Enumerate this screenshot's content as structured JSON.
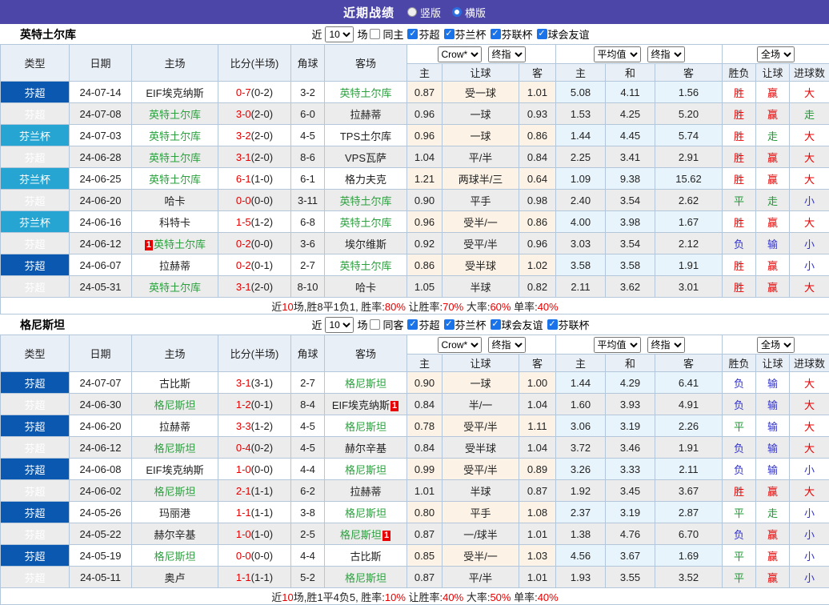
{
  "topbar": {
    "title": "近期战绩",
    "radios": [
      {
        "label": "竖版",
        "selected": false
      },
      {
        "label": "横版",
        "selected": true
      }
    ]
  },
  "icons": {
    "check": "✓"
  },
  "colors": {
    "topbar_purple": "#4c46a8",
    "league_super_blue": "#0a58b0",
    "league_cup_cyan": "#26a5d2",
    "team_highlight_green": "#2d9f3f",
    "win_red": "#e60000",
    "draw_green": "#1d9933",
    "lose_blue": "#3333cc",
    "odds_cream_bg": "#fcf3e6",
    "avg_blue_bg": "#e8f4fb"
  },
  "table_header": {
    "left_cols": [
      "类型",
      "日期",
      "主场",
      "比分(半场)",
      "角球",
      "客场"
    ],
    "odds_cols": [
      "主",
      "让球",
      "客"
    ],
    "avg_cols": [
      "主",
      "和",
      "客"
    ],
    "result_cols": [
      "胜负",
      "让球",
      "进球数"
    ],
    "dropdowns": {
      "crow": "Crow*",
      "final1": "终指",
      "average": "平均值",
      "final2": "终指",
      "fulltime": "全场"
    }
  },
  "sections": [
    {
      "team": "英特土尔库",
      "filter": {
        "prefix": "近",
        "count": "10",
        "suffix": "场",
        "same_label": "同主",
        "leagues": [
          "芬超",
          "芬兰杯",
          "芬联杯",
          "球会友谊"
        ]
      },
      "rows": [
        {
          "lg": "芬超",
          "lgc": "b",
          "d": "24-07-14",
          "h": "EIF埃克纳斯",
          "hg": false,
          "hb": null,
          "s": "0-7",
          "hf": "(0-2)",
          "cn": "3-2",
          "a": "英特土尔库",
          "ag": true,
          "ab": null,
          "o": [
            "0.87",
            "受一球",
            "1.01"
          ],
          "v": [
            "5.08",
            "4.11",
            "1.56"
          ],
          "r": [
            [
              "胜",
              "r"
            ],
            [
              "赢",
              "r"
            ],
            [
              "大",
              "r"
            ]
          ]
        },
        {
          "lg": "芬超",
          "lgc": "b",
          "d": "24-07-08",
          "h": "英特土尔库",
          "hg": true,
          "hb": null,
          "s": "3-0",
          "hf": "(2-0)",
          "cn": "6-0",
          "a": "拉赫蒂",
          "ag": false,
          "ab": null,
          "o": [
            "0.96",
            "一球",
            "0.93"
          ],
          "v": [
            "1.53",
            "4.25",
            "5.20"
          ],
          "r": [
            [
              "胜",
              "r"
            ],
            [
              "赢",
              "r"
            ],
            [
              "走",
              "g"
            ]
          ]
        },
        {
          "lg": "芬兰杯",
          "lgc": "c",
          "d": "24-07-03",
          "h": "英特土尔库",
          "hg": true,
          "hb": null,
          "s": "3-2",
          "hf": "(2-0)",
          "cn": "4-5",
          "a": "TPS土尔库",
          "ag": false,
          "ab": null,
          "o": [
            "0.96",
            "一球",
            "0.86"
          ],
          "v": [
            "1.44",
            "4.45",
            "5.74"
          ],
          "r": [
            [
              "胜",
              "r"
            ],
            [
              "走",
              "g"
            ],
            [
              "大",
              "r"
            ]
          ]
        },
        {
          "lg": "芬超",
          "lgc": "b",
          "d": "24-06-28",
          "h": "英特土尔库",
          "hg": true,
          "hb": null,
          "s": "3-1",
          "hf": "(2-0)",
          "cn": "8-6",
          "a": "VPS瓦萨",
          "ag": false,
          "ab": null,
          "o": [
            "1.04",
            "平/半",
            "0.84"
          ],
          "v": [
            "2.25",
            "3.41",
            "2.91"
          ],
          "r": [
            [
              "胜",
              "r"
            ],
            [
              "赢",
              "r"
            ],
            [
              "大",
              "r"
            ]
          ]
        },
        {
          "lg": "芬兰杯",
          "lgc": "c",
          "d": "24-06-25",
          "h": "英特土尔库",
          "hg": true,
          "hb": null,
          "s": "6-1",
          "hf": "(1-0)",
          "cn": "6-1",
          "a": "格力夫克",
          "ag": false,
          "ab": null,
          "o": [
            "1.21",
            "两球半/三",
            "0.64"
          ],
          "v": [
            "1.09",
            "9.38",
            "15.62"
          ],
          "r": [
            [
              "胜",
              "r"
            ],
            [
              "赢",
              "r"
            ],
            [
              "大",
              "r"
            ]
          ]
        },
        {
          "lg": "芬超",
          "lgc": "b",
          "d": "24-06-20",
          "h": "哈卡",
          "hg": false,
          "hb": null,
          "s": "0-0",
          "hf": "(0-0)",
          "cn": "3-11",
          "a": "英特土尔库",
          "ag": true,
          "ab": null,
          "o": [
            "0.90",
            "平手",
            "0.98"
          ],
          "v": [
            "2.40",
            "3.54",
            "2.62"
          ],
          "r": [
            [
              "平",
              "g"
            ],
            [
              "走",
              "g"
            ],
            [
              "小",
              "b"
            ]
          ]
        },
        {
          "lg": "芬兰杯",
          "lgc": "c",
          "d": "24-06-16",
          "h": "科特卡",
          "hg": false,
          "hb": null,
          "s": "1-5",
          "hf": "(1-2)",
          "cn": "6-8",
          "a": "英特土尔库",
          "ag": true,
          "ab": null,
          "o": [
            "0.96",
            "受半/一",
            "0.86"
          ],
          "v": [
            "4.00",
            "3.98",
            "1.67"
          ],
          "r": [
            [
              "胜",
              "r"
            ],
            [
              "赢",
              "r"
            ],
            [
              "大",
              "r"
            ]
          ]
        },
        {
          "lg": "芬超",
          "lgc": "b",
          "d": "24-06-12",
          "h": "英特土尔库",
          "hg": true,
          "hb": "1",
          "s": "0-2",
          "hf": "(0-0)",
          "cn": "3-6",
          "a": "埃尔维斯",
          "ag": false,
          "ab": null,
          "o": [
            "0.92",
            "受平/半",
            "0.96"
          ],
          "v": [
            "3.03",
            "3.54",
            "2.12"
          ],
          "r": [
            [
              "负",
              "b"
            ],
            [
              "输",
              "b"
            ],
            [
              "小",
              "b"
            ]
          ]
        },
        {
          "lg": "芬超",
          "lgc": "b",
          "d": "24-06-07",
          "h": "拉赫蒂",
          "hg": false,
          "hb": null,
          "s": "0-2",
          "hf": "(0-1)",
          "cn": "2-7",
          "a": "英特土尔库",
          "ag": true,
          "ab": null,
          "o": [
            "0.86",
            "受半球",
            "1.02"
          ],
          "v": [
            "3.58",
            "3.58",
            "1.91"
          ],
          "r": [
            [
              "胜",
              "r"
            ],
            [
              "赢",
              "r"
            ],
            [
              "小",
              "b"
            ]
          ]
        },
        {
          "lg": "芬超",
          "lgc": "b",
          "d": "24-05-31",
          "h": "英特土尔库",
          "hg": true,
          "hb": null,
          "s": "3-1",
          "hf": "(2-0)",
          "cn": "8-10",
          "a": "哈卡",
          "ag": false,
          "ab": null,
          "o": [
            "1.05",
            "半球",
            "0.82"
          ],
          "v": [
            "2.11",
            "3.62",
            "3.01"
          ],
          "r": [
            [
              "胜",
              "r"
            ],
            [
              "赢",
              "r"
            ],
            [
              "大",
              "r"
            ]
          ]
        }
      ],
      "summary": [
        {
          "t": "近",
          "c": "k"
        },
        {
          "t": "10",
          "c": "r"
        },
        {
          "t": "场,胜8平1负1, 胜率:",
          "c": "k"
        },
        {
          "t": "80%",
          "c": "r"
        },
        {
          "t": " 让胜率:",
          "c": "k"
        },
        {
          "t": "70%",
          "c": "r"
        },
        {
          "t": " 大率:",
          "c": "k"
        },
        {
          "t": "60%",
          "c": "r"
        },
        {
          "t": " 单率:",
          "c": "k"
        },
        {
          "t": "40%",
          "c": "r"
        }
      ]
    },
    {
      "team": "格尼斯坦",
      "filter": {
        "prefix": "近",
        "count": "10",
        "suffix": "场",
        "same_label": "同客",
        "leagues": [
          "芬超",
          "芬兰杯",
          "球会友谊",
          "芬联杯"
        ]
      },
      "rows": [
        {
          "lg": "芬超",
          "lgc": "b",
          "d": "24-07-07",
          "h": "古比斯",
          "hg": false,
          "hb": null,
          "s": "3-1",
          "hf": "(3-1)",
          "cn": "2-7",
          "a": "格尼斯坦",
          "ag": true,
          "ab": null,
          "o": [
            "0.90",
            "一球",
            "1.00"
          ],
          "v": [
            "1.44",
            "4.29",
            "6.41"
          ],
          "r": [
            [
              "负",
              "b"
            ],
            [
              "输",
              "b"
            ],
            [
              "大",
              "r"
            ]
          ]
        },
        {
          "lg": "芬超",
          "lgc": "b",
          "d": "24-06-30",
          "h": "格尼斯坦",
          "hg": true,
          "hb": null,
          "s": "1-2",
          "hf": "(0-1)",
          "cn": "8-4",
          "a": "EIF埃克纳斯",
          "ag": false,
          "ab": "1",
          "o": [
            "0.84",
            "半/一",
            "1.04"
          ],
          "v": [
            "1.60",
            "3.93",
            "4.91"
          ],
          "r": [
            [
              "负",
              "b"
            ],
            [
              "输",
              "b"
            ],
            [
              "大",
              "r"
            ]
          ]
        },
        {
          "lg": "芬超",
          "lgc": "b",
          "d": "24-06-20",
          "h": "拉赫蒂",
          "hg": false,
          "hb": null,
          "s": "3-3",
          "hf": "(1-2)",
          "cn": "4-5",
          "a": "格尼斯坦",
          "ag": true,
          "ab": null,
          "o": [
            "0.78",
            "受平/半",
            "1.11"
          ],
          "v": [
            "3.06",
            "3.19",
            "2.26"
          ],
          "r": [
            [
              "平",
              "g"
            ],
            [
              "输",
              "b"
            ],
            [
              "大",
              "r"
            ]
          ]
        },
        {
          "lg": "芬超",
          "lgc": "b",
          "d": "24-06-12",
          "h": "格尼斯坦",
          "hg": true,
          "hb": null,
          "s": "0-4",
          "hf": "(0-2)",
          "cn": "4-5",
          "a": "赫尔辛基",
          "ag": false,
          "ab": null,
          "o": [
            "0.84",
            "受半球",
            "1.04"
          ],
          "v": [
            "3.72",
            "3.46",
            "1.91"
          ],
          "r": [
            [
              "负",
              "b"
            ],
            [
              "输",
              "b"
            ],
            [
              "大",
              "r"
            ]
          ]
        },
        {
          "lg": "芬超",
          "lgc": "b",
          "d": "24-06-08",
          "h": "EIF埃克纳斯",
          "hg": false,
          "hb": null,
          "s": "1-0",
          "hf": "(0-0)",
          "cn": "4-4",
          "a": "格尼斯坦",
          "ag": true,
          "ab": null,
          "o": [
            "0.99",
            "受平/半",
            "0.89"
          ],
          "v": [
            "3.26",
            "3.33",
            "2.11"
          ],
          "r": [
            [
              "负",
              "b"
            ],
            [
              "输",
              "b"
            ],
            [
              "小",
              "b"
            ]
          ]
        },
        {
          "lg": "芬超",
          "lgc": "b",
          "d": "24-06-02",
          "h": "格尼斯坦",
          "hg": true,
          "hb": null,
          "s": "2-1",
          "hf": "(1-1)",
          "cn": "6-2",
          "a": "拉赫蒂",
          "ag": false,
          "ab": null,
          "o": [
            "1.01",
            "半球",
            "0.87"
          ],
          "v": [
            "1.92",
            "3.45",
            "3.67"
          ],
          "r": [
            [
              "胜",
              "r"
            ],
            [
              "赢",
              "r"
            ],
            [
              "大",
              "r"
            ]
          ]
        },
        {
          "lg": "芬超",
          "lgc": "b",
          "d": "24-05-26",
          "h": "玛丽港",
          "hg": false,
          "hb": null,
          "s": "1-1",
          "hf": "(1-1)",
          "cn": "3-8",
          "a": "格尼斯坦",
          "ag": true,
          "ab": null,
          "o": [
            "0.80",
            "平手",
            "1.08"
          ],
          "v": [
            "2.37",
            "3.19",
            "2.87"
          ],
          "r": [
            [
              "平",
              "g"
            ],
            [
              "走",
              "g"
            ],
            [
              "小",
              "b"
            ]
          ]
        },
        {
          "lg": "芬超",
          "lgc": "b",
          "d": "24-05-22",
          "h": "赫尔辛基",
          "hg": false,
          "hb": null,
          "s": "1-0",
          "hf": "(1-0)",
          "cn": "2-5",
          "a": "格尼斯坦",
          "ag": true,
          "ab": "1",
          "o": [
            "0.87",
            "一/球半",
            "1.01"
          ],
          "v": [
            "1.38",
            "4.76",
            "6.70"
          ],
          "r": [
            [
              "负",
              "b"
            ],
            [
              "赢",
              "r"
            ],
            [
              "小",
              "b"
            ]
          ]
        },
        {
          "lg": "芬超",
          "lgc": "b",
          "d": "24-05-19",
          "h": "格尼斯坦",
          "hg": true,
          "hb": null,
          "s": "0-0",
          "hf": "(0-0)",
          "cn": "4-4",
          "a": "古比斯",
          "ag": false,
          "ab": null,
          "o": [
            "0.85",
            "受半/一",
            "1.03"
          ],
          "v": [
            "4.56",
            "3.67",
            "1.69"
          ],
          "r": [
            [
              "平",
              "g"
            ],
            [
              "赢",
              "r"
            ],
            [
              "小",
              "b"
            ]
          ]
        },
        {
          "lg": "芬超",
          "lgc": "b",
          "d": "24-05-11",
          "h": "奥卢",
          "hg": false,
          "hb": null,
          "s": "1-1",
          "hf": "(1-1)",
          "cn": "5-2",
          "a": "格尼斯坦",
          "ag": true,
          "ab": null,
          "o": [
            "0.87",
            "平/半",
            "1.01"
          ],
          "v": [
            "1.93",
            "3.55",
            "3.52"
          ],
          "r": [
            [
              "平",
              "g"
            ],
            [
              "赢",
              "r"
            ],
            [
              "小",
              "b"
            ]
          ]
        }
      ],
      "summary": [
        {
          "t": "近",
          "c": "k"
        },
        {
          "t": "10",
          "c": "r"
        },
        {
          "t": "场,胜1平4负5, 胜率:",
          "c": "k"
        },
        {
          "t": "10%",
          "c": "r"
        },
        {
          "t": " 让胜率:",
          "c": "k"
        },
        {
          "t": "40%",
          "c": "r"
        },
        {
          "t": " 大率:",
          "c": "k"
        },
        {
          "t": "50%",
          "c": "r"
        },
        {
          "t": " 单率:",
          "c": "k"
        },
        {
          "t": "40%",
          "c": "r"
        }
      ]
    }
  ]
}
